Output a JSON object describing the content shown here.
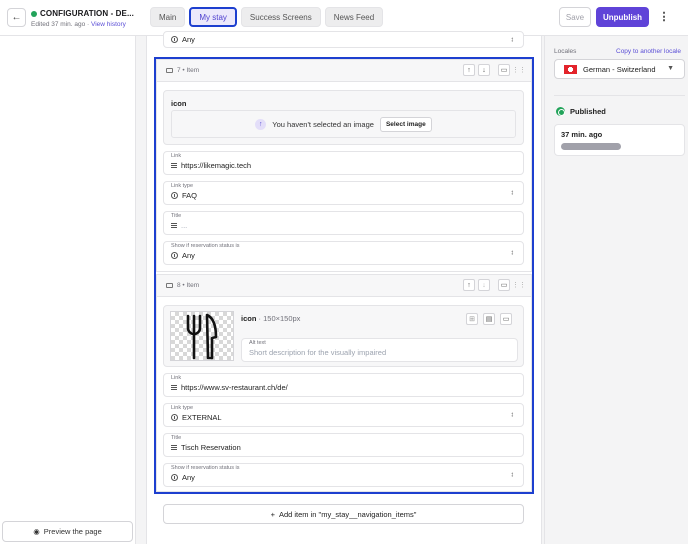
{
  "header": {
    "doc_title": "CONFIGURATION - DE...",
    "edited": "Edited 37 min. ago",
    "sep": "·",
    "view_history": "View history",
    "tabs": [
      {
        "label": "Main"
      },
      {
        "label": "My stay"
      },
      {
        "label": "Success Screens"
      },
      {
        "label": "News Feed"
      }
    ],
    "save_label": "Save",
    "unpublish_label": "Unpublish",
    "status_color": "#22a35a",
    "accent_color": "#5f43d8"
  },
  "editor": {
    "top_field": {
      "value": "Any"
    },
    "item7": {
      "title": "7 • Item",
      "icon_card": {
        "title": "icon",
        "empty_text": "You haven't selected an image",
        "select_button": "Select image"
      },
      "link": {
        "label": "Link",
        "value": "https://likemagic.tech"
      },
      "link_type": {
        "label": "Link type",
        "value": "FAQ"
      },
      "title_field": {
        "label": "Title",
        "value": "..."
      },
      "show_if": {
        "label": "Show if reservation status is",
        "value": "Any"
      }
    },
    "item8": {
      "title": "8 • Item",
      "icon_card": {
        "title": "icon",
        "size": "· 150×150px",
        "alt_label": "Alt text",
        "alt_placeholder": "Short description for the visually impaired"
      },
      "link": {
        "label": "Link",
        "value": "https://www.sv-restaurant.ch/de/"
      },
      "link_type": {
        "label": "Link type",
        "value": "EXTERNAL"
      },
      "title_field": {
        "label": "Title",
        "value": "Tisch Reservation"
      },
      "show_if": {
        "label": "Show if reservation status is",
        "value": "Any"
      }
    },
    "add_item": "Add item in \"my_stay__navigation_items\""
  },
  "sidebar": {
    "preview": "Preview the page"
  },
  "right_panel": {
    "locales_label": "Locales",
    "copy_link": "Copy to another locale",
    "locale": "German - Switzerland",
    "status": "Published",
    "published_time": "37 min. ago"
  }
}
